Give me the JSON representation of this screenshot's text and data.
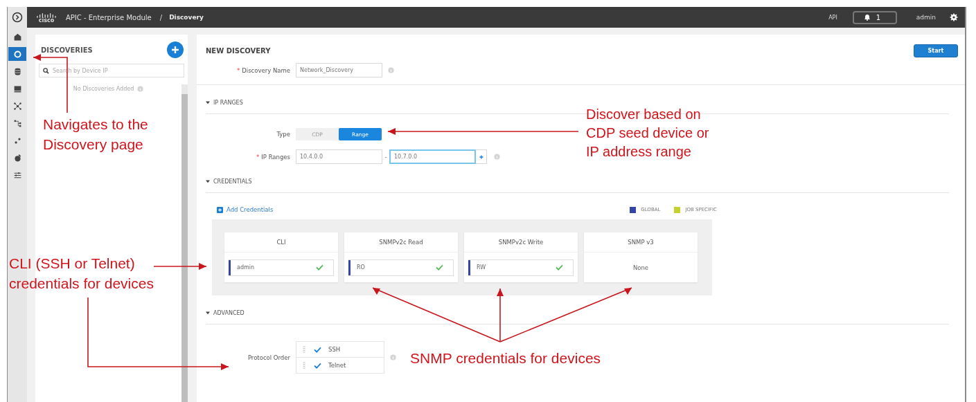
{
  "app_bar": {
    "logo_text": "cisco",
    "product": "APIC - Enterprise Module",
    "separator": "/",
    "page": "Discovery",
    "api": "API",
    "notifications": "1",
    "user": "admin"
  },
  "nav_rail": [
    {
      "selected": false
    },
    {
      "selected": true
    },
    {
      "selected": false
    },
    {
      "selected": false
    },
    {
      "selected": false
    },
    {
      "selected": false
    },
    {
      "selected": false
    },
    {
      "selected": false
    },
    {
      "selected": false
    }
  ],
  "discoveries_panel": {
    "title": "DISCOVERIES",
    "search_placeholder": "Search by Device IP",
    "empty_message": "No Discoveries Added"
  },
  "form": {
    "title": "NEW DISCOVERY",
    "start_button": "Start",
    "discovery_name": {
      "label": "Discovery Name",
      "required_mark": "*",
      "value": "Network_Discovery"
    },
    "ip_ranges": {
      "heading": "IP RANGES",
      "expanded": true,
      "type_label": "Type",
      "type_options": [
        {
          "label": "CDP",
          "selected": false
        },
        {
          "label": "Range",
          "selected": true
        }
      ],
      "ranges_label": "IP Ranges",
      "required_mark": "*",
      "from": "10.4.0.0",
      "separator": "-",
      "to": "10.7.0.0"
    },
    "credentials": {
      "heading": "CREDENTIALS",
      "expanded": true,
      "add_link": "Add Credentials",
      "legend": [
        {
          "label": "GLOBAL",
          "color": "#3444a8"
        },
        {
          "label": "JOB SPECIFIC",
          "color": "#c5d12c"
        }
      ],
      "cards": [
        {
          "title": "CLI",
          "kind": "entry",
          "value": "admin",
          "color": "#3444a8",
          "valid": true
        },
        {
          "title": "SNMPv2c Read",
          "kind": "entry",
          "value": "RO",
          "color": "#3444a8",
          "valid": true
        },
        {
          "title": "SNMPv2c Write",
          "kind": "entry",
          "value": "RW",
          "color": "#3444a8",
          "valid": true
        },
        {
          "title": "SNMP v3",
          "kind": "none",
          "value": "None"
        }
      ]
    },
    "advanced": {
      "heading": "ADVANCED",
      "expanded": true,
      "protocol_label": "Protocol Order",
      "protocols": [
        {
          "label": "SSH",
          "checked": true
        },
        {
          "label": "Telnet",
          "checked": true
        }
      ]
    }
  },
  "annotations": [
    {
      "lines": [
        "Navigates  to the",
        "Discovery  page"
      ]
    },
    {
      "lines": [
        "Discover based on",
        "CDP seed device  or",
        "IP address range"
      ]
    },
    {
      "lines": [
        "CLI (SSH or Telnet)",
        "credentials for devices"
      ]
    },
    {
      "lines": [
        "SNMP credentials for devices"
      ]
    }
  ]
}
